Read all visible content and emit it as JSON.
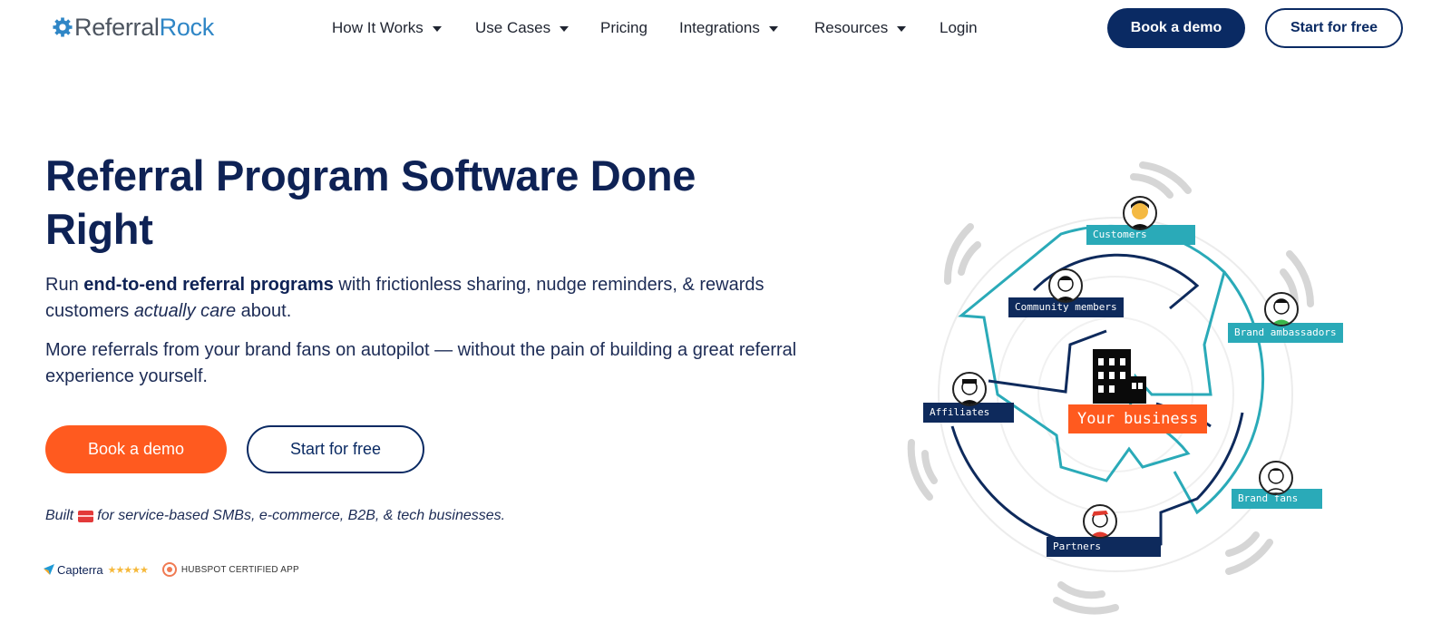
{
  "brand": {
    "logo_word1": "Referral",
    "logo_word2": "Rock",
    "colors": {
      "navy": "#0a2a63",
      "orange": "#ff5a1f",
      "teal": "#2aaab8",
      "logo_blue": "#2f86c6"
    }
  },
  "nav": {
    "items": [
      {
        "label": "How It Works",
        "has_dropdown": true
      },
      {
        "label": "Use Cases",
        "has_dropdown": true
      },
      {
        "label": "Pricing",
        "has_dropdown": false
      },
      {
        "label": "Integrations",
        "has_dropdown": true
      },
      {
        "label": "Resources",
        "has_dropdown": true
      },
      {
        "label": "Login",
        "has_dropdown": false
      }
    ],
    "book_demo": "Book a demo",
    "start_free": "Start for free"
  },
  "hero": {
    "title": "Referral Program Software Done Right",
    "p1": {
      "pre": "Run ",
      "bold": "end-to-end referral programs",
      "mid": " with frictionless sharing, nudge reminders, & rewards customers ",
      "italic": "actually care",
      "post": " about."
    },
    "p2": "More referrals from your brand fans on autopilot — without the pain of building a great referral experience yourself.",
    "cta_primary": "Book a demo",
    "cta_secondary": "Start for free",
    "built": {
      "pre": "Built",
      "post": "for service-based SMBs, e-commerce, B2B, & tech businesses."
    },
    "badges": {
      "capterra": "Capterra",
      "capterra_stars": "★★★★★",
      "hubspot": "HUBSPOT CERTIFIED APP"
    }
  },
  "illustration": {
    "center_label": "Your business",
    "labels": {
      "customers": "Customers",
      "community": "Community members",
      "ambassadors": "Brand ambassadors",
      "affiliates": "Affiliates",
      "fans": "Brand fans",
      "partners": "Partners"
    }
  }
}
